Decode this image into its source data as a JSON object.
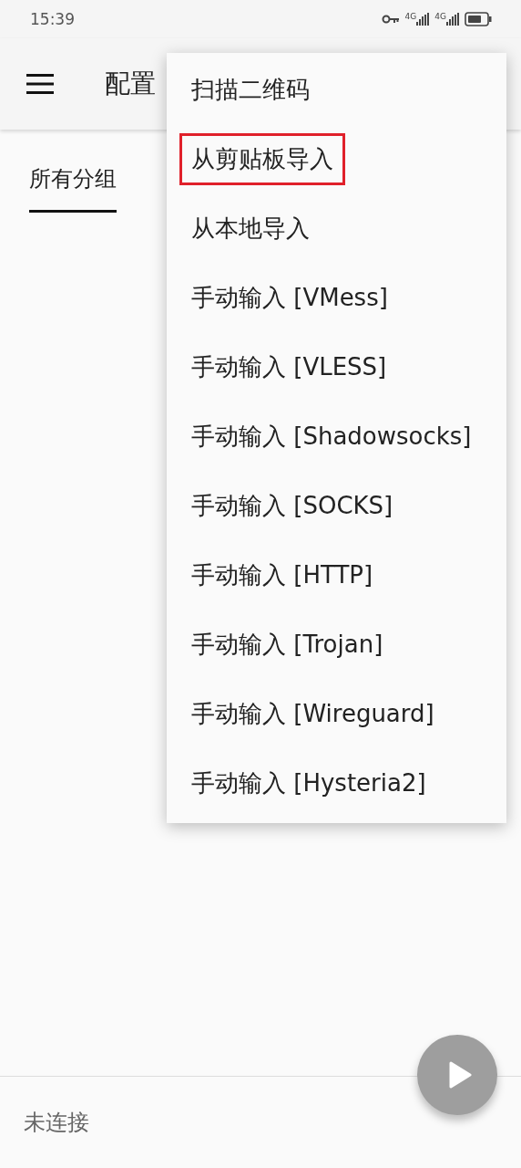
{
  "status_bar": {
    "time": "15:39",
    "networks": [
      "4G",
      "4G"
    ]
  },
  "toolbar": {
    "title": "配置"
  },
  "tabs": [
    {
      "label": "所有分组",
      "selected": true
    }
  ],
  "menu": {
    "items": [
      {
        "label": "扫描二维码",
        "highlighted": false
      },
      {
        "label": "从剪贴板导入",
        "highlighted": true
      },
      {
        "label": "从本地导入",
        "highlighted": false
      },
      {
        "label": "手动输入 [VMess]",
        "highlighted": false
      },
      {
        "label": "手动输入 [VLESS]",
        "highlighted": false
      },
      {
        "label": "手动输入 [Shadowsocks]",
        "highlighted": false
      },
      {
        "label": "手动输入 [SOCKS]",
        "highlighted": false
      },
      {
        "label": "手动输入 [HTTP]",
        "highlighted": false
      },
      {
        "label": "手动输入 [Trojan]",
        "highlighted": false
      },
      {
        "label": "手动输入 [Wireguard]",
        "highlighted": false
      },
      {
        "label": "手动输入 [Hysteria2]",
        "highlighted": false
      }
    ]
  },
  "footer": {
    "status": "未连接"
  }
}
